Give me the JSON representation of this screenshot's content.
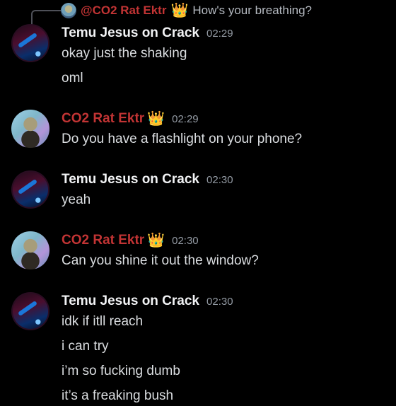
{
  "reply_preview": {
    "name": "@CO2 Rat Ektr",
    "crown": "👑",
    "text": "How's your breathing?"
  },
  "messages": [
    {
      "author": "Temu Jesus on Crack",
      "time": "02:29",
      "lines": [
        "okay just the shaking",
        "oml"
      ]
    },
    {
      "author": "CO2 Rat Ektr",
      "crown": "👑",
      "time": "02:29",
      "lines": [
        "Do you have a flashlight on your phone?"
      ]
    },
    {
      "author": "Temu Jesus on Crack",
      "time": "02:30",
      "lines": [
        "yeah"
      ]
    },
    {
      "author": "CO2 Rat Ektr",
      "crown": "👑",
      "time": "02:30",
      "lines": [
        "Can you shine it out the window?"
      ]
    },
    {
      "author": "Temu Jesus on Crack",
      "time": "02:30",
      "lines": [
        "idk if itll reach",
        "i can try",
        "i’m so fucking dumb",
        "it’s a freaking bush"
      ]
    }
  ],
  "colors": {
    "background": "#000000",
    "co2_name": "#c23434",
    "temu_name": "#f2f3f5",
    "timestamp": "#949ba4"
  }
}
